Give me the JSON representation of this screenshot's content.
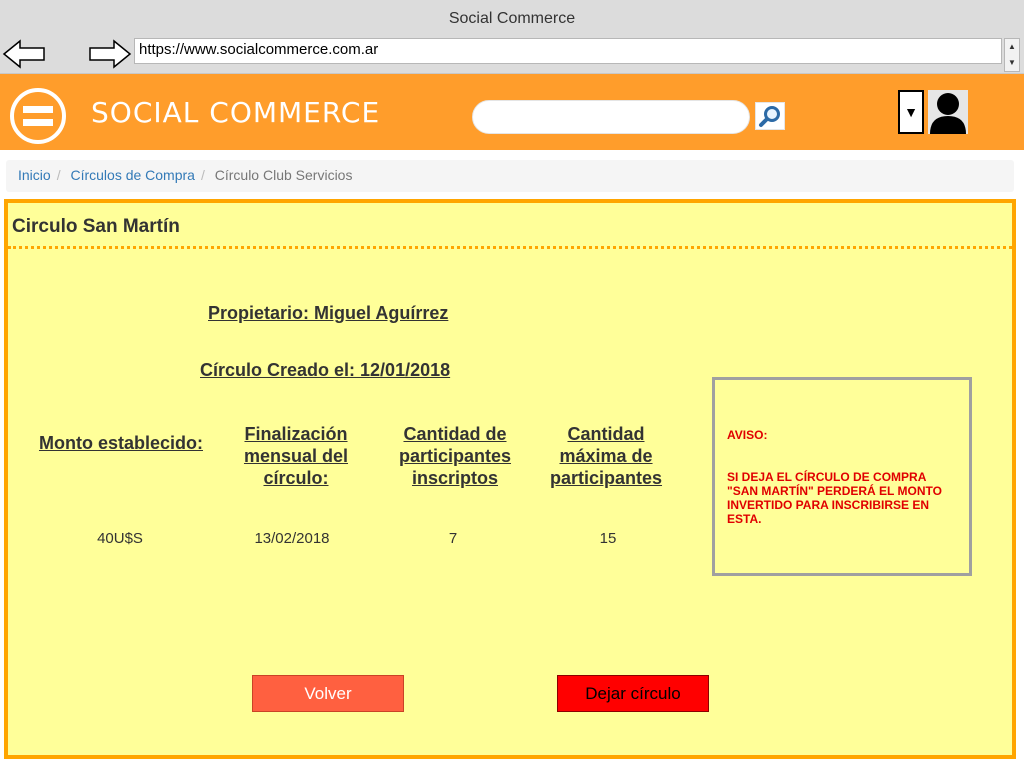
{
  "browser": {
    "window_title": "Social Commerce",
    "url": "https://www.socialcommerce.com.ar"
  },
  "header": {
    "brand": "SOCIAL COMMERCE",
    "search_placeholder": "",
    "icons": [
      "menu-icon",
      "search-icon",
      "dropdown-arrow-icon",
      "user-avatar-icon"
    ]
  },
  "breadcrumb": {
    "items": [
      "Inicio",
      "Círculos de Compra",
      "Círculo Club Servicios"
    ]
  },
  "panel": {
    "title": "Circulo San Martín",
    "owner": "Propietario: Miguel Aguírrez",
    "created": "Círculo Creado el: 12/01/2018",
    "columns": [
      {
        "header": "Monto establecido:",
        "value": "40U$S"
      },
      {
        "header": "Finalización mensual del círculo:",
        "value": "13/02/2018"
      },
      {
        "header": "Cantidad de participantes inscriptos",
        "value": "7"
      },
      {
        "header": "Cantidad máxima de participantes",
        "value": "15"
      }
    ],
    "notice": {
      "title": "AVISO:",
      "body": "SI DEJA EL CÍRCULO DE COMPRA \"SAN MARTÍN\" PERDERÁ EL MONTO INVERTIDO PARA INSCRIBIRSE EN ESTA."
    },
    "buttons": {
      "back": "Volver",
      "leave": "Dejar círculo"
    }
  },
  "colors": {
    "header_orange": "#ff9d2b",
    "panel_bg": "#ffff99",
    "panel_border": "#ffa500",
    "back_button": "#ff6040",
    "leave_button": "#ff0000",
    "notice_text": "#e00000",
    "link": "#337ab7"
  }
}
